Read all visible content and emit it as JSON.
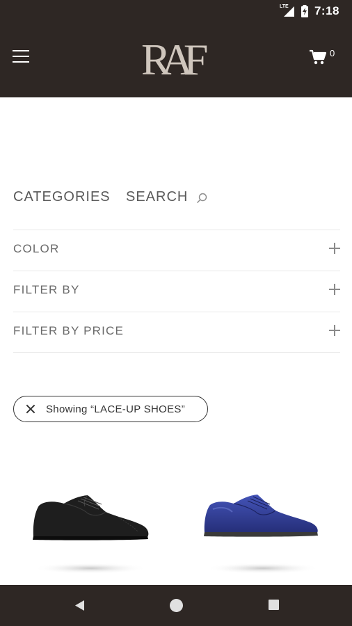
{
  "status_bar": {
    "network": "LTE",
    "time": "7:18"
  },
  "header": {
    "logo_text": "RAF",
    "cart_count": "0"
  },
  "filters": {
    "tabs": [
      {
        "label": "CATEGORIES"
      },
      {
        "label": "SEARCH"
      }
    ],
    "accordion": [
      {
        "label": "COLOR"
      },
      {
        "label": "FILTER BY"
      },
      {
        "label": "FILTER BY PRICE"
      }
    ]
  },
  "active_filter": {
    "label": "Showing “LACE-UP SHOES”"
  },
  "products": [
    {
      "color_name": "black",
      "shoe_color": "#1e1e1e"
    },
    {
      "color_name": "blue",
      "shoe_color": "#2f3a8c"
    }
  ],
  "colors": {
    "brand_dark": "#2e2724",
    "logo": "#cfc6bd",
    "text": "#5a5a5a"
  }
}
